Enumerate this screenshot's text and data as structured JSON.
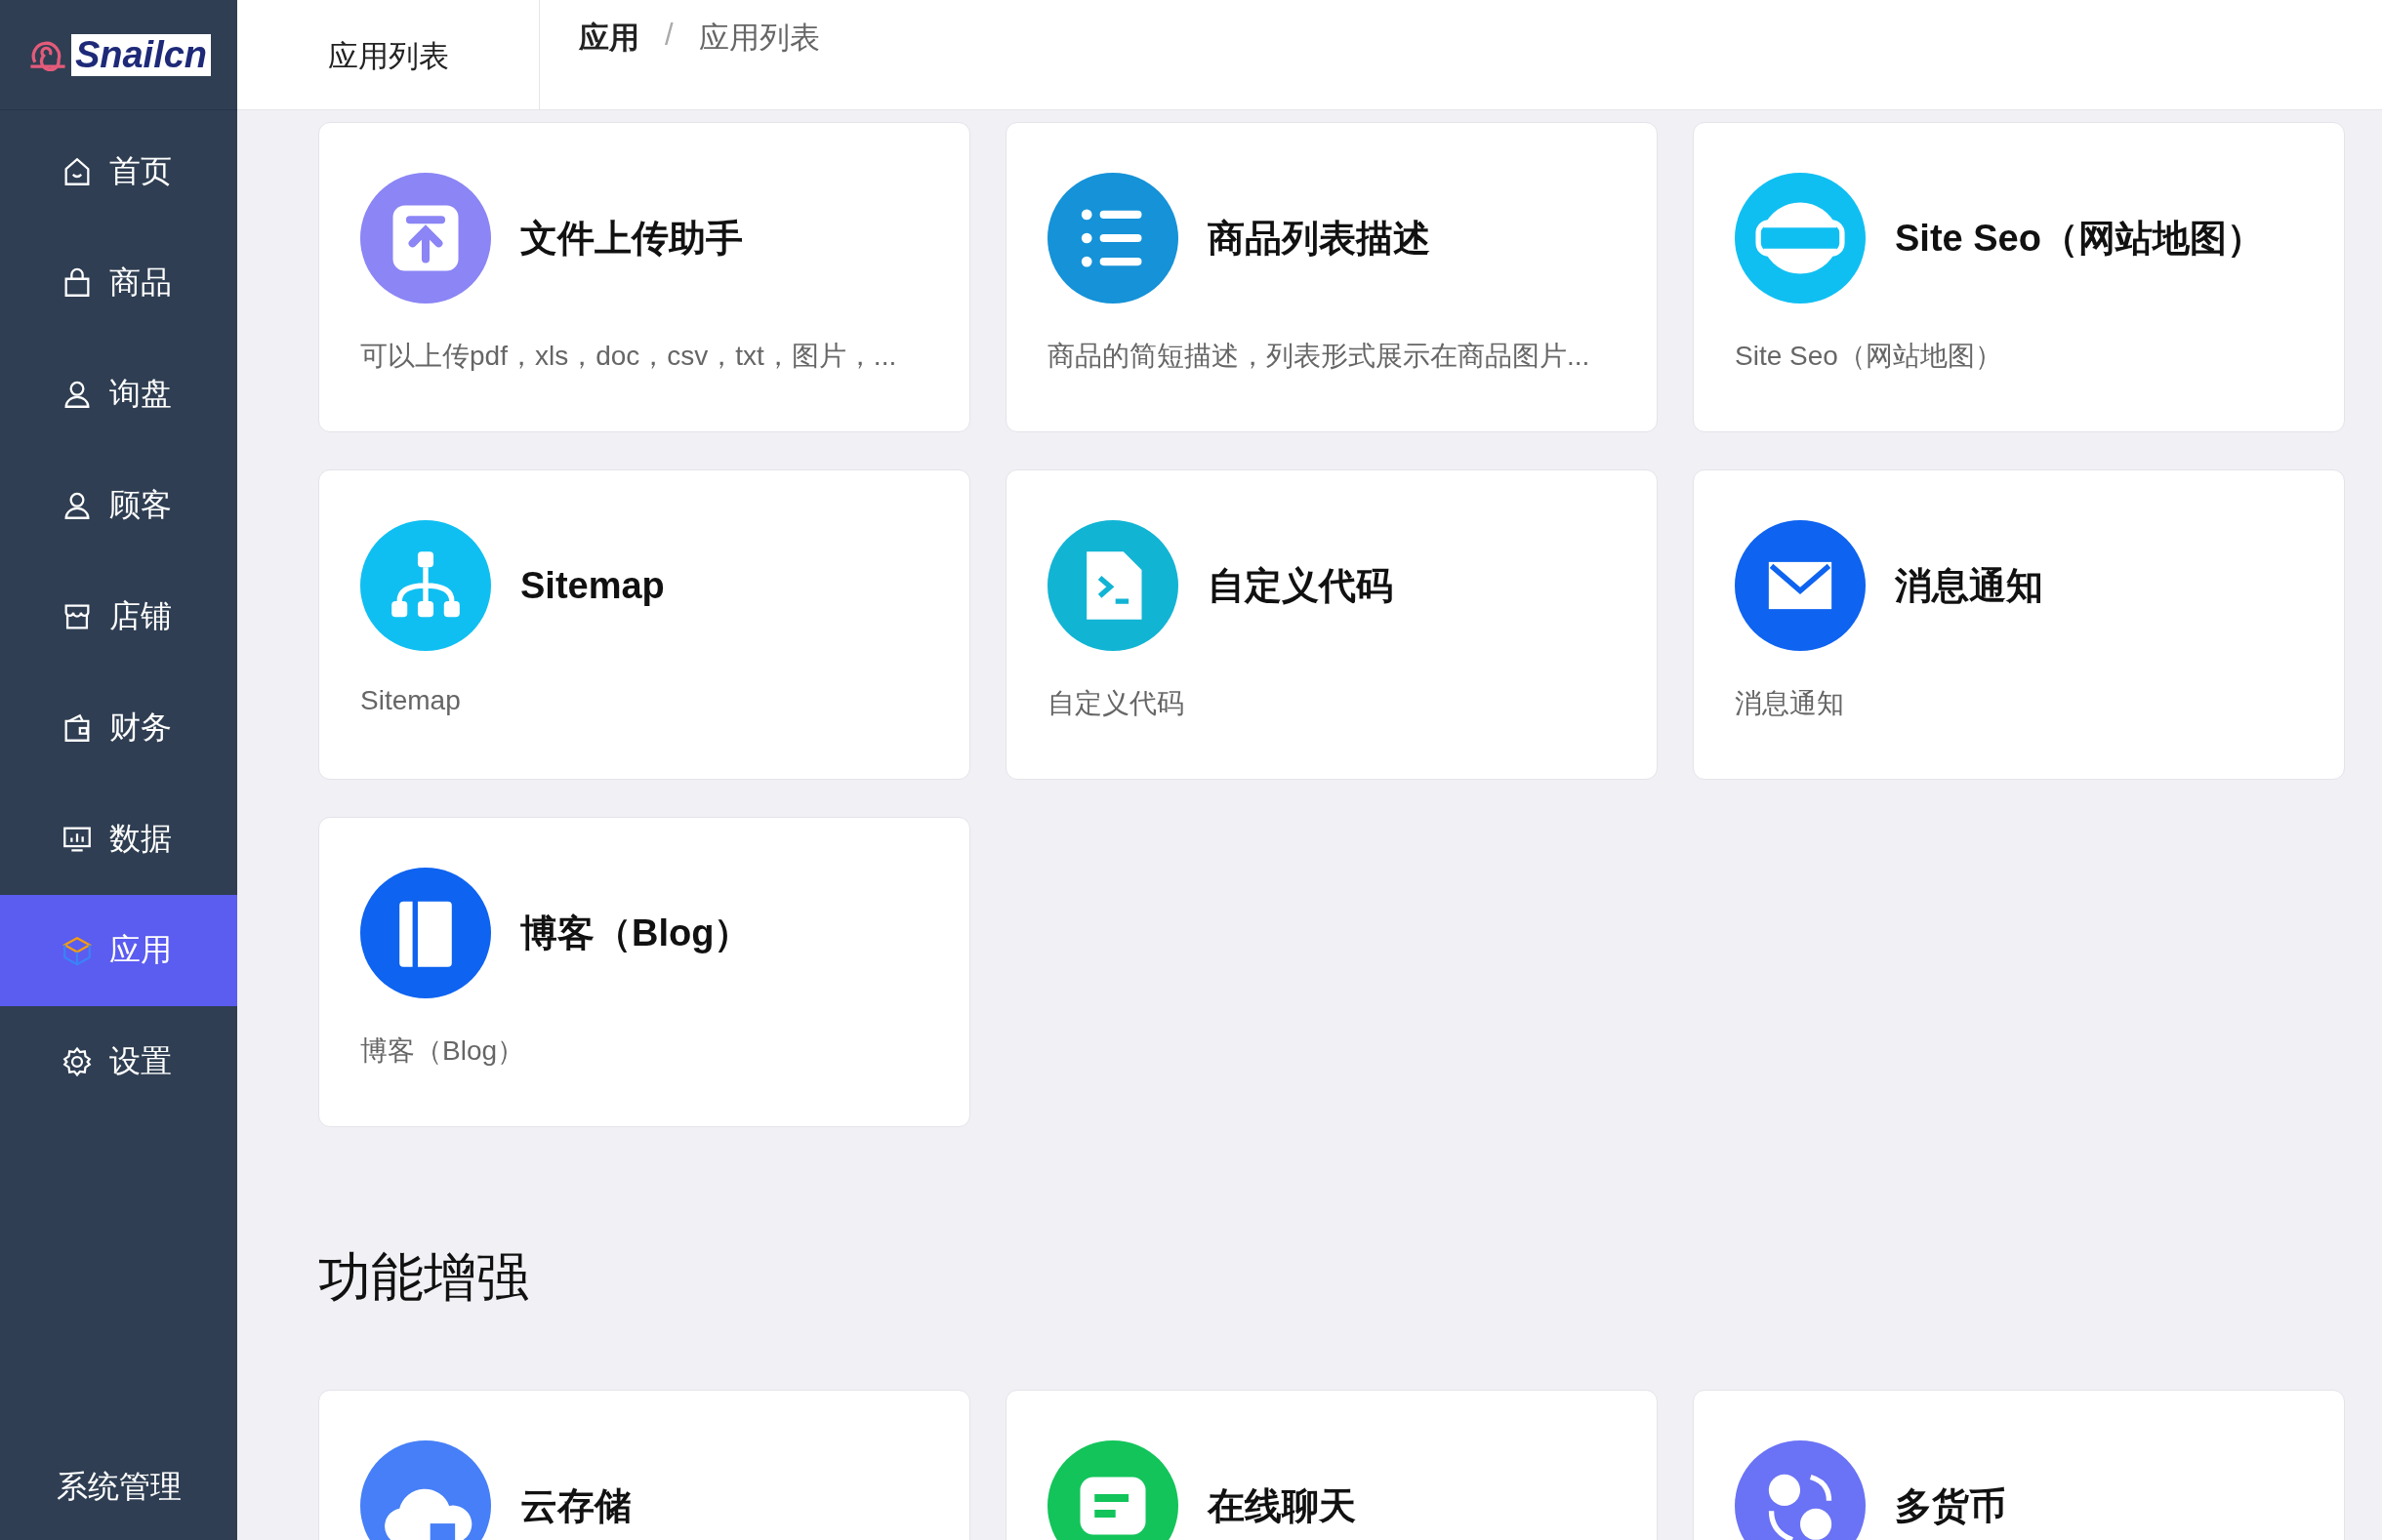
{
  "sidebar": {
    "logo": "Snailcn",
    "items": [
      {
        "label": "首页",
        "kind": "home",
        "selected": false
      },
      {
        "label": "商品",
        "kind": "bag",
        "selected": false
      },
      {
        "label": "询盘",
        "kind": "user",
        "selected": false
      },
      {
        "label": "顾客",
        "kind": "user",
        "selected": false
      },
      {
        "label": "店铺",
        "kind": "store",
        "selected": false
      },
      {
        "label": "财务",
        "kind": "wallet",
        "selected": false
      },
      {
        "label": "数据",
        "kind": "chart",
        "selected": false
      },
      {
        "label": "应用",
        "kind": "box",
        "selected": true
      },
      {
        "label": "设置",
        "kind": "gear",
        "selected": false
      }
    ],
    "footer": "系统管理"
  },
  "header": {
    "tab": "应用列表",
    "breadcrumb": [
      "应用",
      "应用列表"
    ],
    "separator": "/"
  },
  "apps": [
    {
      "title": "文件上传助手",
      "description": "可以上传pdf，xls，doc，csv，txt，图片，...",
      "kind": "upload",
      "color": "#8b85f5"
    },
    {
      "title": "商品列表描述",
      "description": "商品的简短描述，列表形式展示在商品图片...",
      "kind": "list",
      "color": "#1592d8"
    },
    {
      "title": "Site Seo（网站地图）",
      "description": "Site Seo（网站地图）",
      "kind": "seo",
      "color": "#10bff2"
    },
    {
      "title": "Sitemap",
      "description": "Sitemap",
      "kind": "sitemap",
      "color": "#10bff2"
    },
    {
      "title": "自定义代码",
      "description": "自定义代码",
      "kind": "code",
      "color": "#12b4d4"
    },
    {
      "title": "消息通知",
      "description": "消息通知",
      "kind": "mail",
      "color": "#0e63f0"
    },
    {
      "title": "博客（Blog）",
      "description": "博客（Blog）",
      "kind": "book",
      "color": "#0e63f0"
    }
  ],
  "section": {
    "heading": "功能增强",
    "apps": [
      {
        "title": "云存储",
        "kind": "cloud",
        "color": "#467ff7"
      },
      {
        "title": "在线聊天",
        "kind": "chat",
        "color": "#12c45a"
      },
      {
        "title": "多货币",
        "kind": "currency",
        "color": "#6a72f5"
      }
    ]
  }
}
